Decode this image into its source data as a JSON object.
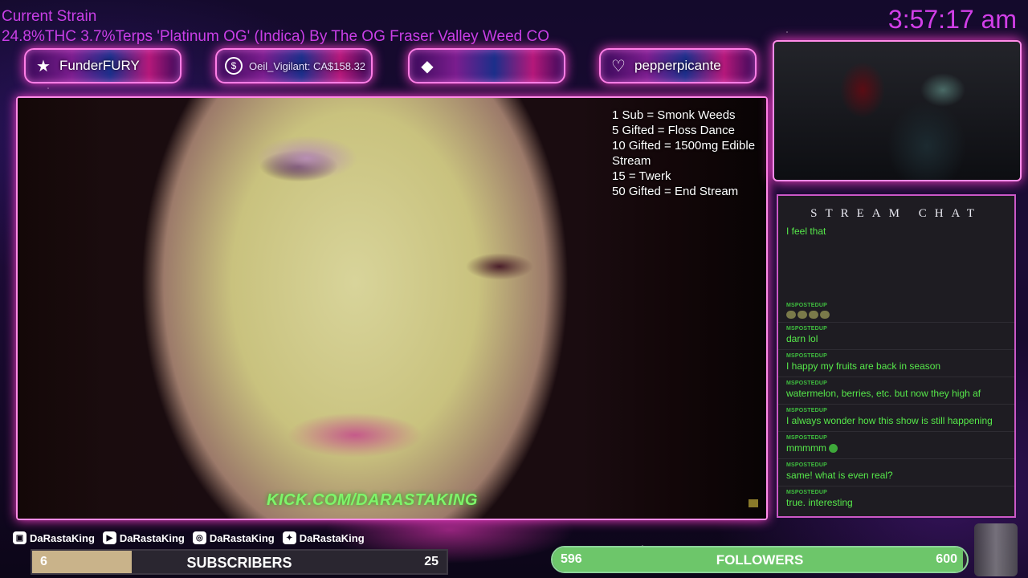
{
  "strain": {
    "title": "Current Strain",
    "description": "24.8%THC 3.7%Terps 'Platinum OG' (Indica) By The OG Fraser Valley Weed CO"
  },
  "clock": "3:57:17 am",
  "alerts": [
    {
      "icon": "star-icon",
      "text": "FunderFURY"
    },
    {
      "icon": "dollar-icon",
      "text": "Oeil_Vigilant: CA$158.32"
    },
    {
      "icon": "diamond-icon",
      "text": ""
    },
    {
      "icon": "heart-icon",
      "text": "pepperpicante"
    }
  ],
  "goals": [
    "1 Sub = Smonk Weeds",
    "5 Gifted = Floss Dance",
    "10 Gifted = 1500mg Edible",
    "Stream",
    "15 = Twerk",
    "50 Gifted = End Stream"
  ],
  "kick_url": "KICK.COM/DARASTAKING",
  "chat": {
    "title": "STREAM CHAT",
    "first_line": "I feel that",
    "messages": [
      {
        "user": "MSPOSTEDUP",
        "text": ""
      },
      {
        "user": "MSPOSTEDUP",
        "text": "darn lol"
      },
      {
        "user": "MSPOSTEDUP",
        "text": "I happy my fruits are back in season"
      },
      {
        "user": "MSPOSTEDUP",
        "text": "watermelon, berries, etc. but now they high af"
      },
      {
        "user": "MSPOSTEDUP",
        "text": "I always wonder how this show is still happening"
      },
      {
        "user": "MSPOSTEDUP",
        "text": "mmmmm"
      },
      {
        "user": "MSPOSTEDUP",
        "text": "same! what is even real?"
      },
      {
        "user": "MSPOSTEDUP",
        "text": "true. interesting"
      }
    ]
  },
  "socials": [
    {
      "icon": "twitch-icon",
      "handle": "DaRastaKing"
    },
    {
      "icon": "youtube-icon",
      "handle": "DaRastaKing"
    },
    {
      "icon": "instagram-icon",
      "handle": "DaRastaKing"
    },
    {
      "icon": "twitter-icon",
      "handle": "DaRastaKing"
    }
  ],
  "subscribers": {
    "label": "SUBSCRIBERS",
    "current": "6",
    "target": "25",
    "progress": 0.24
  },
  "followers": {
    "label": "FOLLOWERS",
    "current": "596",
    "target": "600",
    "progress": 0.99
  },
  "colors": {
    "accent": "#d23fe8",
    "chat_text": "#56e84a",
    "kick_green": "#7ef56a",
    "followers_fill": "#6dc66a"
  }
}
